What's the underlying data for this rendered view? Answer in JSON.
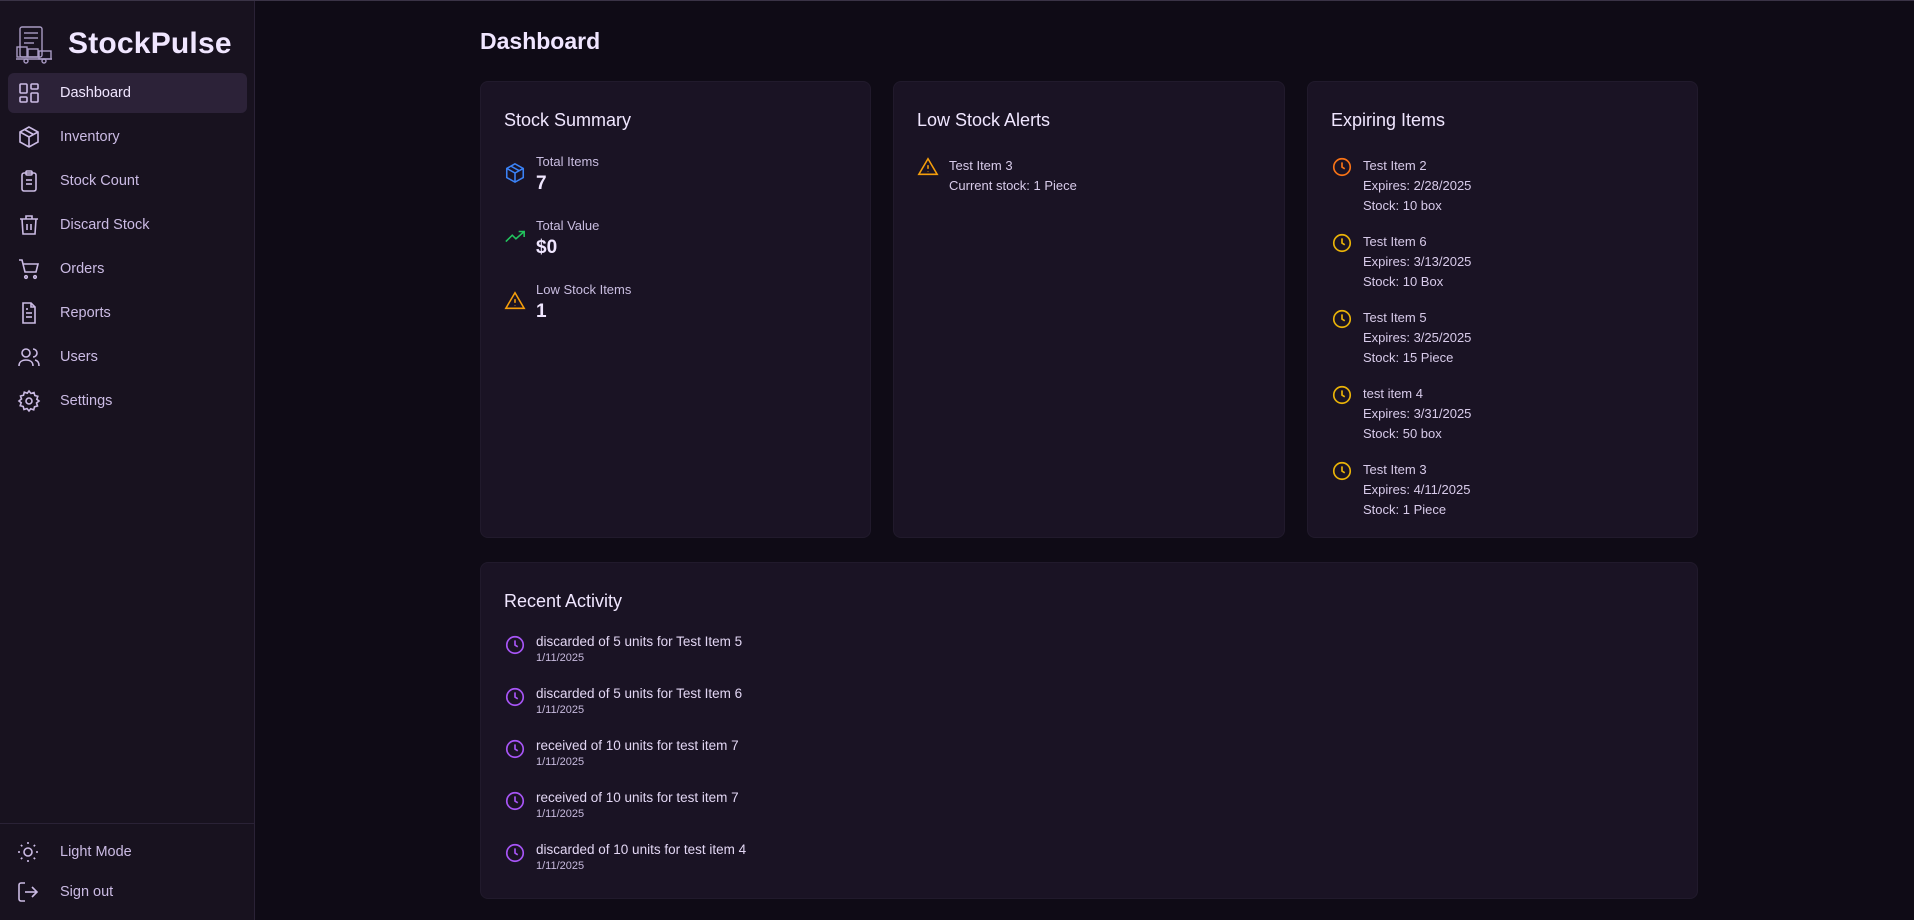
{
  "app": {
    "name": "StockPulse"
  },
  "nav": {
    "items": [
      {
        "label": "Dashboard",
        "icon": "grid-icon",
        "active": true
      },
      {
        "label": "Inventory",
        "icon": "box-icon"
      },
      {
        "label": "Stock Count",
        "icon": "clipboard-icon"
      },
      {
        "label": "Discard Stock",
        "icon": "trash-icon"
      },
      {
        "label": "Orders",
        "icon": "cart-icon"
      },
      {
        "label": "Reports",
        "icon": "document-icon"
      },
      {
        "label": "Users",
        "icon": "users-icon"
      },
      {
        "label": "Settings",
        "icon": "gear-icon"
      }
    ],
    "light_mode": "Light Mode",
    "sign_out": "Sign out"
  },
  "page": {
    "title": "Dashboard"
  },
  "stock_summary": {
    "title": "Stock Summary",
    "total_items": {
      "label": "Total Items",
      "value": "7"
    },
    "total_value": {
      "label": "Total Value",
      "value": "$0"
    },
    "low_stock_items": {
      "label": "Low Stock Items",
      "value": "1"
    }
  },
  "low_stock_alerts": {
    "title": "Low Stock Alerts",
    "items": [
      {
        "name": "Test Item 3",
        "detail": "Current stock: 1 Piece"
      }
    ]
  },
  "expiring_items": {
    "title": "Expiring Items",
    "items": [
      {
        "name": "Test Item 2",
        "expires": "Expires: 2/28/2025",
        "stock": "Stock: 10 box",
        "color": "#f97316"
      },
      {
        "name": "Test Item 6",
        "expires": "Expires: 3/13/2025",
        "stock": "Stock: 10 Box",
        "color": "#eab308"
      },
      {
        "name": "Test Item 5",
        "expires": "Expires: 3/25/2025",
        "stock": "Stock: 15 Piece",
        "color": "#eab308"
      },
      {
        "name": "test item 4",
        "expires": "Expires: 3/31/2025",
        "stock": "Stock: 50 box",
        "color": "#eab308"
      },
      {
        "name": "Test Item 3",
        "expires": "Expires: 4/11/2025",
        "stock": "Stock: 1 Piece",
        "color": "#eab308"
      }
    ]
  },
  "recent_activity": {
    "title": "Recent Activity",
    "items": [
      {
        "text": "discarded of 5 units for Test Item 5",
        "date": "1/11/2025"
      },
      {
        "text": "discarded of 5 units for Test Item 6",
        "date": "1/11/2025"
      },
      {
        "text": "received of 10 units for test item 7",
        "date": "1/11/2025"
      },
      {
        "text": "received of 10 units for test item 7",
        "date": "1/11/2025"
      },
      {
        "text": "discarded of 10 units for test item 4",
        "date": "1/11/2025"
      }
    ]
  },
  "colors": {
    "accent": "#a855f7",
    "info": "#3b82f6",
    "success": "#22c55e",
    "warning": "#f59e0b",
    "danger": "#f97316"
  }
}
